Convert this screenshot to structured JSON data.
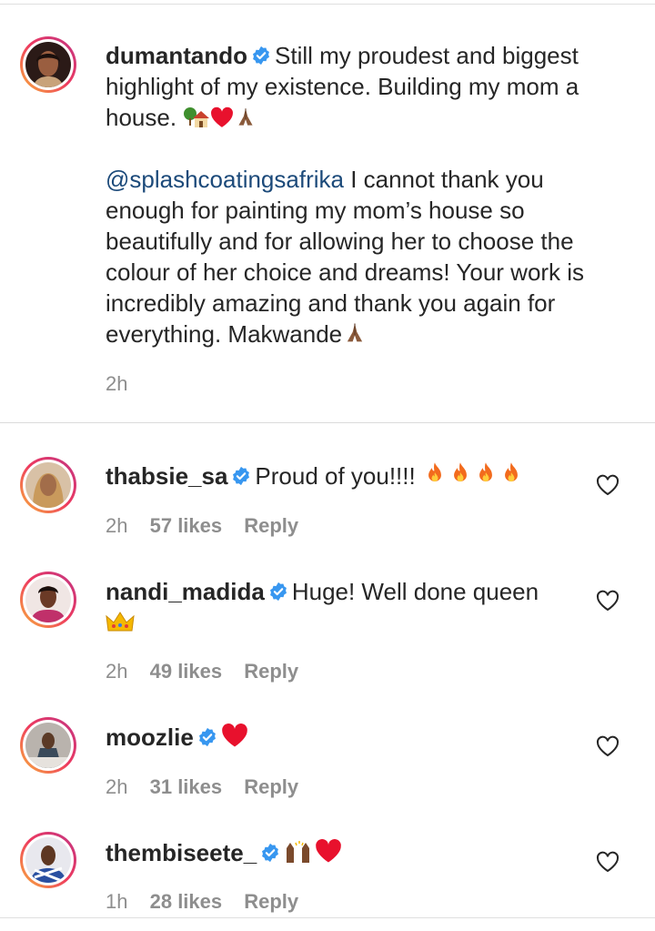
{
  "caption": {
    "username": "dumantando",
    "line1": "Still my proudest and biggest",
    "line2": "highlight of my existence. Building my mom a",
    "line3": "house.",
    "mention": "@splashcoatingsafrika",
    "body1": " I cannot thank you",
    "body2": "enough for painting my mom’s house so",
    "body3": "beautifully and for allowing her to choose the",
    "body4": "colour of her choice and dreams! Your work is",
    "body5": "incredibly amazing and thank you again for",
    "body6": "everything. Makwande",
    "time": "2h"
  },
  "comments": [
    {
      "username": "thabsie_sa",
      "text": "Proud of you!!!!",
      "time": "2h",
      "likes": "57 likes",
      "reply": "Reply"
    },
    {
      "username": "nandi_madida",
      "text": "Huge! Well done queen",
      "time": "2h",
      "likes": "49 likes",
      "reply": "Reply"
    },
    {
      "username": "moozlie",
      "text": "",
      "time": "2h",
      "likes": "31 likes",
      "reply": "Reply"
    },
    {
      "username": "thembiseete_",
      "text": "",
      "time": "1h",
      "likes": "28 likes",
      "reply": "Reply"
    }
  ],
  "icons": {
    "verified": "verified-badge-icon",
    "like": "heart-outline-icon"
  },
  "colors": {
    "verified": "#3897f0",
    "mention": "#1c4a7a",
    "meta": "#8e8e8e",
    "heart_emoji": "#e8112d",
    "fire": "#f26b1d"
  }
}
